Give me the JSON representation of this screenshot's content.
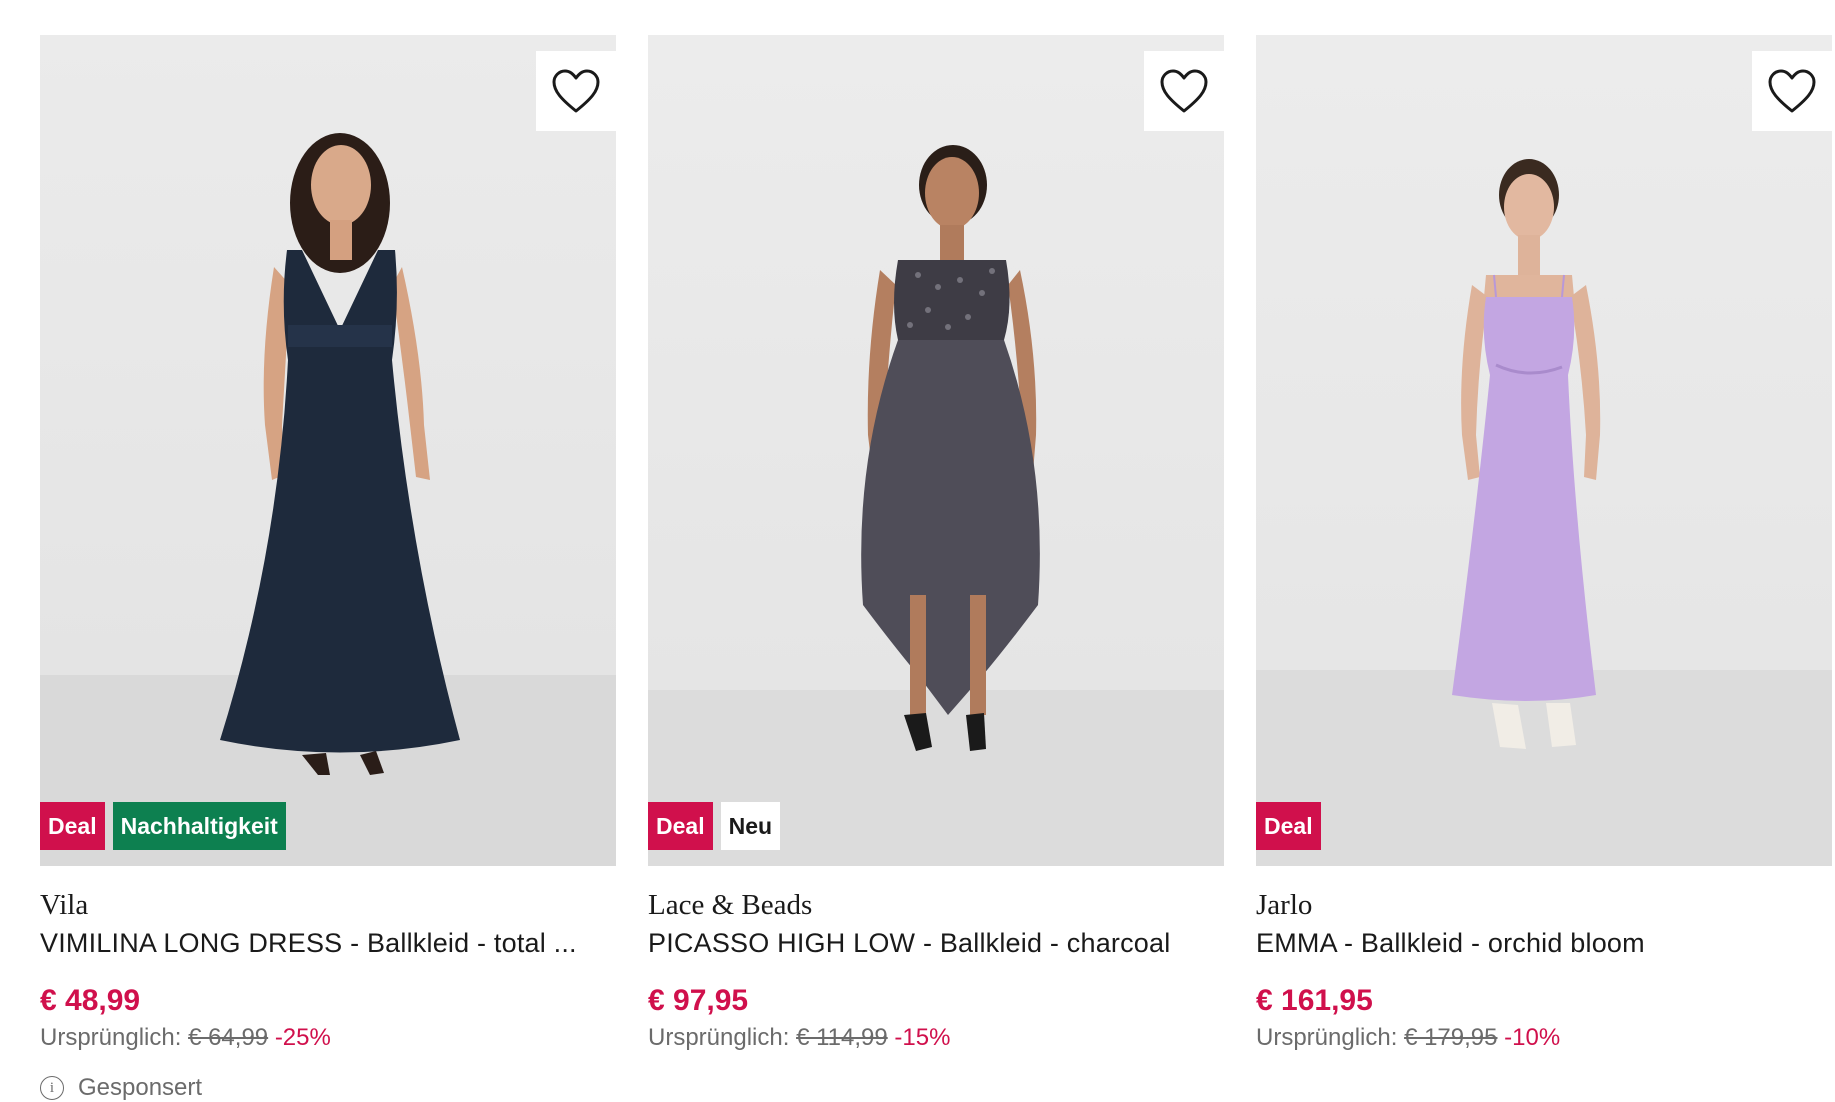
{
  "products": [
    {
      "brand": "Vila",
      "name": "VIMILINA LONG DRESS - Ballkleid - total ...",
      "price": "€ 48,99",
      "original_label": "Ursprünglich:",
      "original_price": "€ 64,99",
      "discount": "-25%",
      "flags": [
        {
          "label": "Deal",
          "bg": "#d0104c",
          "fg": "#ffffff"
        },
        {
          "label": "Nachhaltigkeit",
          "bg": "#0d8050",
          "fg": "#ffffff"
        }
      ],
      "wishlist_icon": "heart-icon",
      "dress_color": "#1e2a3c",
      "dress_shape": "long-vneck"
    },
    {
      "brand": "Lace & Beads",
      "name": "PICASSO HIGH LOW - Ballkleid - charcoal",
      "price": "€ 97,95",
      "original_label": "Ursprünglich:",
      "original_price": "€ 114,99",
      "discount": "-15%",
      "flags": [
        {
          "label": "Deal",
          "bg": "#d0104c",
          "fg": "#ffffff"
        },
        {
          "label": "Neu",
          "bg": "#ffffff",
          "fg": "#1a1a1a"
        }
      ],
      "wishlist_icon": "heart-icon",
      "dress_color": "#4f4d58",
      "dress_shape": "high-low"
    },
    {
      "brand": "Jarlo",
      "name": "EMMA - Ballkleid - orchid bloom",
      "price": "€ 161,95",
      "original_label": "Ursprünglich:",
      "original_price": "€ 179,95",
      "discount": "-10%",
      "flags": [
        {
          "label": "Deal",
          "bg": "#d0104c",
          "fg": "#ffffff"
        }
      ],
      "wishlist_icon": "heart-icon",
      "dress_color": "#c3a6e2",
      "dress_shape": "slip"
    }
  ],
  "sponsored_label": "Gesponsert",
  "sponsored_icon": "info-icon",
  "colors": {
    "accent": "#d0104c",
    "sustainability": "#0d8050",
    "muted": "#6b6b6b"
  }
}
